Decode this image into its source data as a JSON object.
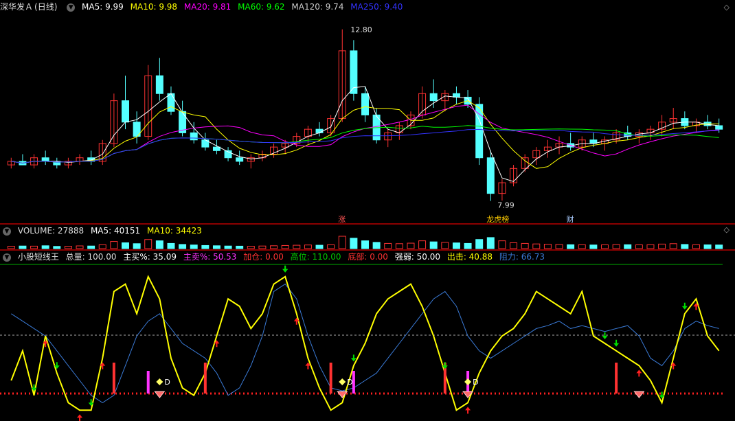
{
  "main": {
    "stock": "深华发Ａ",
    "period": "(日线)",
    "ma5": "MA5: 9.99",
    "ma10": "MA10: 9.98",
    "ma20": "MA20: 9.81",
    "ma60": "MA60: 9.62",
    "ma120": "MA120: 9.74",
    "ma250": "MA250: 9.40",
    "high_label": "12.80",
    "low_label": "7.99",
    "events": [
      "涨",
      "龙虎榜",
      "财"
    ]
  },
  "volume": {
    "label": "VOLUME: 27888",
    "ma5": "MA5: 40151",
    "ma10": "MA10: 34423"
  },
  "indicator": {
    "name": "小股短线王",
    "total": "总量: 100.00",
    "buy": "主买%: 35.09",
    "sell": "主卖%: 50.53",
    "add": "加仓: 0.00",
    "high": "高位: 110.00",
    "bottom": "底部: 0.00",
    "strength": "强弱: 50.00",
    "strike": "出击: 40.88",
    "resist": "阻力: 66.73",
    "d_label": "D"
  },
  "colors": {
    "up": "#ff3232",
    "down": "#54ffff",
    "ma5": "#ffffff",
    "ma10": "#ffff00",
    "ma20": "#ff00ff",
    "ma60": "#00ff00",
    "ma120": "#bbbbbb",
    "ma250": "#3333ff",
    "line_yellow": "#ffff00",
    "line_blue": "#3a7ad6"
  },
  "chart_data": {
    "type": "candlestick",
    "ylim": [
      7.5,
      13.2
    ],
    "candles": [
      [
        9.0,
        9.2,
        8.9,
        9.1
      ],
      [
        9.1,
        9.3,
        9.0,
        9.0
      ],
      [
        9.0,
        9.3,
        8.9,
        9.2
      ],
      [
        9.2,
        9.4,
        9.0,
        9.1
      ],
      [
        9.1,
        9.2,
        8.9,
        9.0
      ],
      [
        9.0,
        9.2,
        8.9,
        9.1
      ],
      [
        9.1,
        9.3,
        9.0,
        9.2
      ],
      [
        9.2,
        9.4,
        9.0,
        9.1
      ],
      [
        9.1,
        9.7,
        9.0,
        9.6
      ],
      [
        9.6,
        11.0,
        9.5,
        10.8
      ],
      [
        10.8,
        11.5,
        10.0,
        10.2
      ],
      [
        10.2,
        10.5,
        9.6,
        9.8
      ],
      [
        9.8,
        11.8,
        9.7,
        11.5
      ],
      [
        11.5,
        12.0,
        10.8,
        11.0
      ],
      [
        11.0,
        11.2,
        10.4,
        10.5
      ],
      [
        10.5,
        10.8,
        9.8,
        9.9
      ],
      [
        9.9,
        10.2,
        9.6,
        9.7
      ],
      [
        9.7,
        9.9,
        9.4,
        9.5
      ],
      [
        9.5,
        9.7,
        9.3,
        9.4
      ],
      [
        9.4,
        9.5,
        9.1,
        9.2
      ],
      [
        9.2,
        9.4,
        9.0,
        9.1
      ],
      [
        9.1,
        9.3,
        8.9,
        9.2
      ],
      [
        9.2,
        9.4,
        9.1,
        9.3
      ],
      [
        9.3,
        9.6,
        9.2,
        9.5
      ],
      [
        9.5,
        9.7,
        9.3,
        9.6
      ],
      [
        9.6,
        9.9,
        9.5,
        9.8
      ],
      [
        9.8,
        10.1,
        9.6,
        10.0
      ],
      [
        10.0,
        10.2,
        9.8,
        9.9
      ],
      [
        9.9,
        10.4,
        9.8,
        10.3
      ],
      [
        10.3,
        12.8,
        10.2,
        12.2
      ],
      [
        12.2,
        12.5,
        10.8,
        11.0
      ],
      [
        11.0,
        11.2,
        10.2,
        10.4
      ],
      [
        10.4,
        10.6,
        9.6,
        9.7
      ],
      [
        9.7,
        10.0,
        9.5,
        9.9
      ],
      [
        9.9,
        10.2,
        9.7,
        10.1
      ],
      [
        10.1,
        10.5,
        10.0,
        10.4
      ],
      [
        10.4,
        11.2,
        10.3,
        11.0
      ],
      [
        11.0,
        11.4,
        10.6,
        10.8
      ],
      [
        10.8,
        11.1,
        10.5,
        11.0
      ],
      [
        11.0,
        11.2,
        10.7,
        10.9
      ],
      [
        10.9,
        11.1,
        10.6,
        10.7
      ],
      [
        10.7,
        10.9,
        9.0,
        9.2
      ],
      [
        9.2,
        9.4,
        7.99,
        8.2
      ],
      [
        8.2,
        8.6,
        8.0,
        8.5
      ],
      [
        8.5,
        9.0,
        8.4,
        8.9
      ],
      [
        8.9,
        9.3,
        8.8,
        9.2
      ],
      [
        9.2,
        9.5,
        9.0,
        9.4
      ],
      [
        9.4,
        9.7,
        9.2,
        9.5
      ],
      [
        9.5,
        9.8,
        9.3,
        9.6
      ],
      [
        9.6,
        9.9,
        9.4,
        9.5
      ],
      [
        9.5,
        9.8,
        9.4,
        9.7
      ],
      [
        9.7,
        9.9,
        9.5,
        9.6
      ],
      [
        9.6,
        9.8,
        9.4,
        9.7
      ],
      [
        9.7,
        10.0,
        9.6,
        9.9
      ],
      [
        9.9,
        10.1,
        9.7,
        9.8
      ],
      [
        9.8,
        10.0,
        9.6,
        9.9
      ],
      [
        9.9,
        10.1,
        9.7,
        10.0
      ],
      [
        10.0,
        10.4,
        9.8,
        10.2
      ],
      [
        10.2,
        10.6,
        10.0,
        10.3
      ],
      [
        10.3,
        10.5,
        10.0,
        10.1
      ],
      [
        10.1,
        10.3,
        9.9,
        10.2
      ],
      [
        10.2,
        10.4,
        10.0,
        10.1
      ],
      [
        10.1,
        10.3,
        9.9,
        10.0
      ]
    ],
    "volumes": [
      18,
      20,
      19,
      22,
      17,
      18,
      21,
      20,
      30,
      55,
      45,
      38,
      70,
      60,
      40,
      32,
      28,
      24,
      22,
      20,
      19,
      18,
      20,
      22,
      24,
      26,
      28,
      26,
      30,
      95,
      80,
      60,
      48,
      40,
      38,
      42,
      60,
      52,
      48,
      44,
      40,
      70,
      85,
      60,
      45,
      40,
      36,
      34,
      32,
      30,
      30,
      28,
      29,
      31,
      30,
      29,
      30,
      35,
      38,
      32,
      30,
      29,
      28
    ],
    "yellow_line": [
      0.25,
      0.45,
      0.15,
      0.55,
      0.3,
      0.1,
      0.05,
      0.05,
      0.4,
      0.85,
      0.9,
      0.7,
      0.95,
      0.8,
      0.4,
      0.2,
      0.15,
      0.3,
      0.55,
      0.8,
      0.75,
      0.6,
      0.7,
      0.9,
      0.95,
      0.7,
      0.4,
      0.2,
      0.05,
      0.1,
      0.35,
      0.5,
      0.7,
      0.8,
      0.85,
      0.9,
      0.75,
      0.55,
      0.3,
      0.05,
      0.1,
      0.3,
      0.45,
      0.55,
      0.6,
      0.7,
      0.85,
      0.8,
      0.75,
      0.7,
      0.85,
      0.55,
      0.5,
      0.45,
      0.4,
      0.35,
      0.25,
      0.1,
      0.4,
      0.7,
      0.8,
      0.55,
      0.45
    ],
    "blue_line": [
      0.7,
      0.65,
      0.6,
      0.55,
      0.45,
      0.35,
      0.25,
      0.15,
      0.1,
      0.15,
      0.35,
      0.55,
      0.65,
      0.7,
      0.6,
      0.5,
      0.45,
      0.4,
      0.3,
      0.15,
      0.2,
      0.35,
      0.55,
      0.85,
      0.9,
      0.8,
      0.55,
      0.35,
      0.2,
      0.18,
      0.2,
      0.25,
      0.3,
      0.4,
      0.5,
      0.6,
      0.7,
      0.8,
      0.85,
      0.75,
      0.55,
      0.45,
      0.4,
      0.45,
      0.5,
      0.55,
      0.6,
      0.62,
      0.65,
      0.6,
      0.62,
      0.6,
      0.58,
      0.6,
      0.62,
      0.55,
      0.4,
      0.35,
      0.45,
      0.6,
      0.65,
      0.62,
      0.6
    ]
  }
}
